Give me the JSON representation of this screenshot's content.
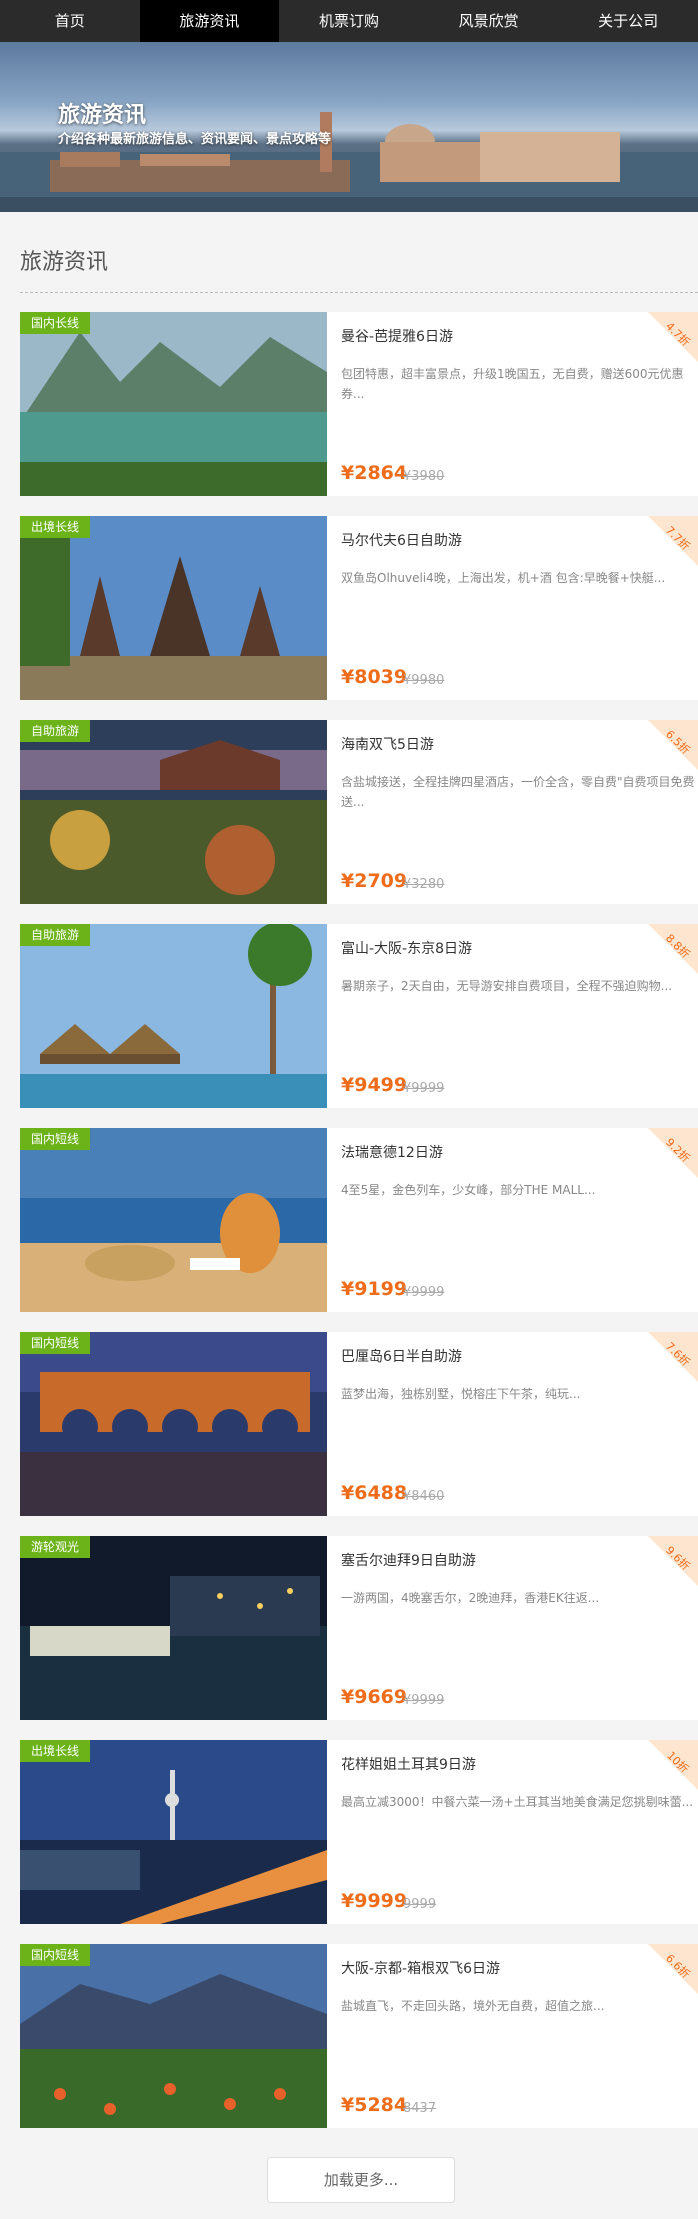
{
  "nav": [
    "首页",
    "旅游资讯",
    "机票订购",
    "风景欣赏",
    "关于公司"
  ],
  "banner": {
    "title": "旅游资讯",
    "subtitle": "介绍各种最新旅游信息、资讯要闻、景点攻略等"
  },
  "section": {
    "title": "旅游资讯"
  },
  "colors": {
    "tag": "#6cb31a",
    "price": "#ef6c1a",
    "nav": "#2b2b2b",
    "nav_active": "#000000"
  },
  "cards": [
    {
      "tag": "国内长线",
      "title": "曼谷-芭提雅6日游",
      "desc": "包团特惠，超丰富景点，升级1晚国五，无自费，赠送600元优惠券...",
      "price": "¥2864",
      "orig": "¥3980",
      "discount": "4.7折"
    },
    {
      "tag": "出境长线",
      "title": "马尔代夫6日自助游",
      "desc": "双鱼岛Olhuveli4晚，上海出发，机+酒 包含:早晚餐+快艇...",
      "price": "¥8039",
      "orig": "¥9980",
      "discount": "7.7折"
    },
    {
      "tag": "自助旅游",
      "title": "海南双飞5日游",
      "desc": "含盐城接送，全程挂牌四星酒店，一价全含，零自费\"自费项目免费送...",
      "price": "¥2709",
      "orig": "¥3280",
      "discount": "6.5折"
    },
    {
      "tag": "自助旅游",
      "title": "富山-大阪-东京8日游",
      "desc": "暑期亲子，2天自由，无导游安排自费项目，全程不强迫购物...",
      "price": "¥9499",
      "orig": "¥9999",
      "discount": "8.8折"
    },
    {
      "tag": "国内短线",
      "title": "法瑞意德12日游",
      "desc": "4至5星，金色列车，少女峰，部分THE MALL...",
      "price": "¥9199",
      "orig": "¥9999",
      "discount": "9.2折"
    },
    {
      "tag": "国内短线",
      "title": "巴厘岛6日半自助游",
      "desc": "蓝梦出海，独栋别墅，悦榕庄下午茶，纯玩...",
      "price": "¥6488",
      "orig": "¥8460",
      "discount": "7.6折"
    },
    {
      "tag": "游轮观光",
      "title": "塞舌尔迪拜9日自助游",
      "desc": "一游两国，4晚塞舌尔，2晚迪拜，香港EK往返...",
      "price": "¥9669",
      "orig": "¥9999",
      "discount": "9.6折"
    },
    {
      "tag": "出境长线",
      "title": "花样姐姐土耳其9日游",
      "desc": "最高立减3000！中餐六菜一汤+土耳其当地美食满足您挑剔味蕾...",
      "price": "¥9999",
      "orig": "9999",
      "discount": "10折"
    },
    {
      "tag": "国内短线",
      "title": "大阪-京都-箱根双飞6日游",
      "desc": "盐城直飞，不走回头路，境外无自费，超值之旅...",
      "price": "¥5284",
      "orig": "8437",
      "discount": "6.6折"
    }
  ],
  "load_more": "加载更多..."
}
